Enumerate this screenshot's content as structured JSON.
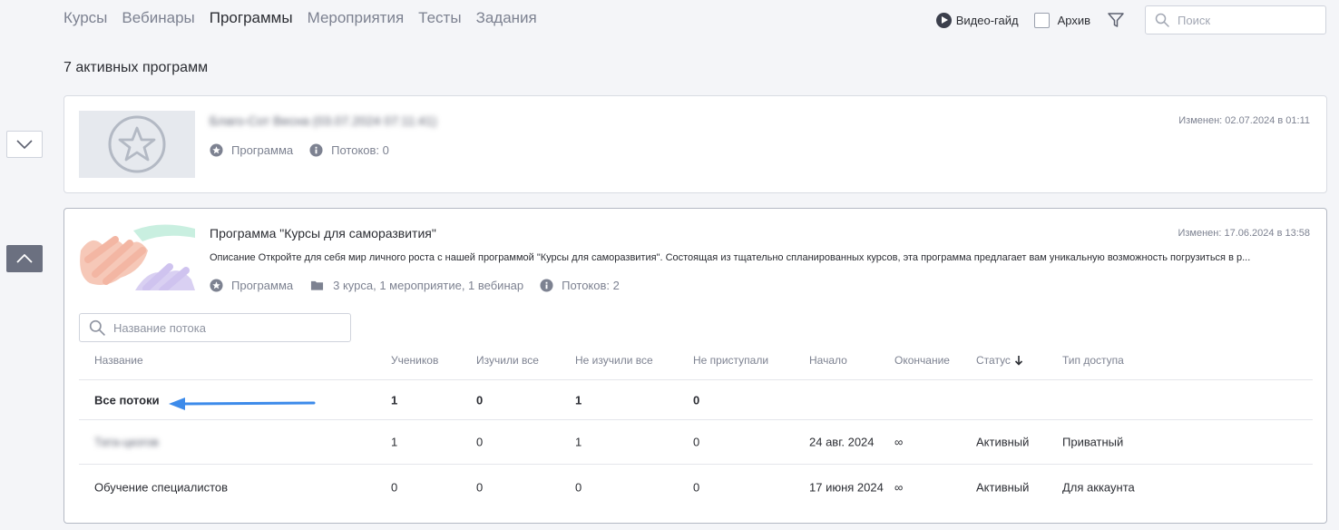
{
  "nav": {
    "tabs": [
      {
        "label": "Курсы",
        "active": false
      },
      {
        "label": "Вебинары",
        "active": false
      },
      {
        "label": "Программы",
        "active": true
      },
      {
        "label": "Мероприятия",
        "active": false
      },
      {
        "label": "Тесты",
        "active": false
      },
      {
        "label": "Задания",
        "active": false
      }
    ]
  },
  "toolbar": {
    "video_guide": "Видео-гайд",
    "archive": "Архив",
    "archive_checked": false,
    "search_placeholder": "Поиск"
  },
  "page": {
    "title": "7 активных программ"
  },
  "programs": [
    {
      "name": "Благо-Сот Весна (03.07.2024 07:11:41)",
      "type": "Программа",
      "streams": "Потоков: 0",
      "modified": "Изменен: 02.07.2024 в 01:11",
      "expanded": false
    },
    {
      "name": "Программа \"Курсы для саморазвития\"",
      "description": "Описание Откройте для себя мир личного роста с нашей программой \"Курсы для саморазвития\". Состоящая из тщательно спланированных курсов, эта программа предлагает вам уникальную возможность погрузиться в р...",
      "type": "Программа",
      "contents": "3 курса, 1 мероприятие, 1 вебинар",
      "streams": "Потоков: 2",
      "modified": "Изменен: 17.06.2024 в 13:58",
      "expanded": true,
      "stream_search_placeholder": "Название потока",
      "table": {
        "headers": {
          "name": "Название",
          "students": "Учеников",
          "studied_all": "Изучили все",
          "not_studied_all": "Не изучили все",
          "not_started": "Не приступали",
          "start": "Начало",
          "end": "Окончание",
          "status": "Статус",
          "access": "Тип доступа"
        },
        "all_streams": {
          "name": "Все потоки",
          "students": "1",
          "studied_all": "0",
          "not_studied_all": "1",
          "not_started": "0"
        },
        "rows": [
          {
            "name": "Тата-цкогов",
            "students": "1",
            "studied_all": "0",
            "not_studied_all": "1",
            "not_started": "0",
            "start": "24 авг. 2024",
            "end": "∞",
            "status": "Активный",
            "access": "Приватный"
          },
          {
            "name": "Обучение специалистов",
            "students": "0",
            "studied_all": "0",
            "not_studied_all": "0",
            "not_started": "0",
            "start": "17 июня 2024",
            "end": "∞",
            "status": "Активный",
            "access": "Для аккаунта"
          }
        ]
      }
    }
  ],
  "colors": {
    "annotation_arrow": "#3d8bea",
    "collapse_button": "#6b7080"
  }
}
